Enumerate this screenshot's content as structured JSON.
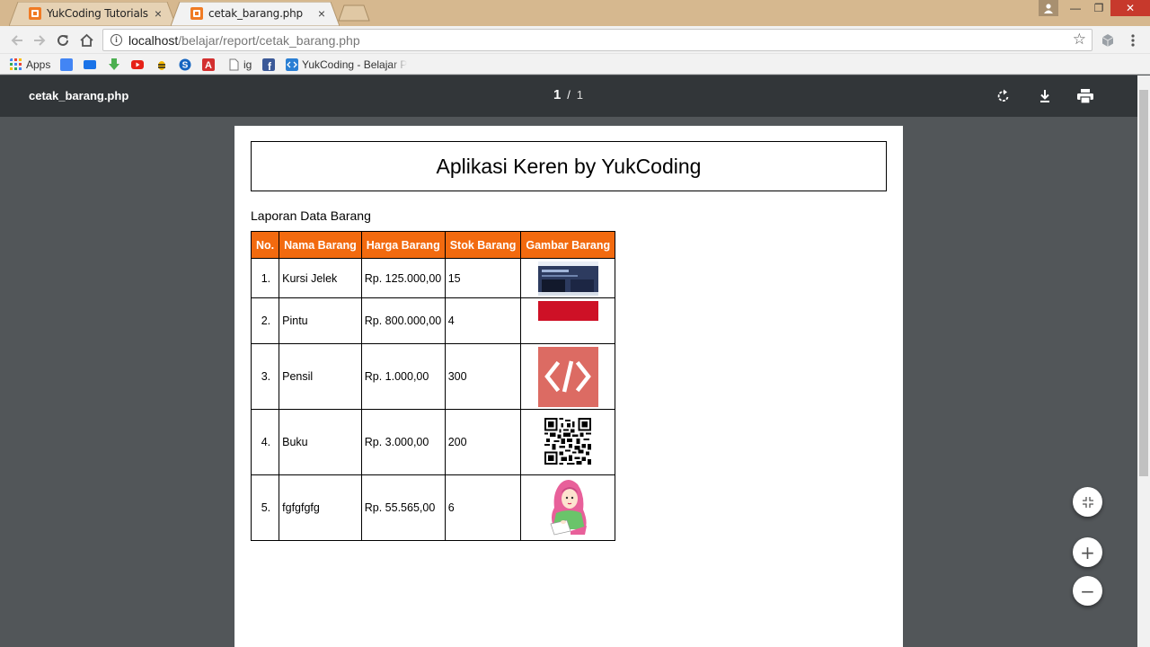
{
  "browser": {
    "tabs": [
      {
        "title": "YukCoding Tutorials",
        "close": "×",
        "active": false
      },
      {
        "title": "cetak_barang.php",
        "close": "×",
        "active": true
      }
    ],
    "window_controls": {
      "minimize": "—",
      "restore": "❐",
      "close": "✕"
    },
    "url": {
      "host": "localhost",
      "path": "/belajar/report/cetak_barang.php"
    },
    "bookmarks": [
      {
        "label": "Apps",
        "icon": "apps-grid-icon"
      },
      {
        "label": "",
        "icon": "translate-icon"
      },
      {
        "label": "",
        "icon": "reader-icon"
      },
      {
        "label": "",
        "icon": "download-arrow-icon"
      },
      {
        "label": "",
        "icon": "youtube-icon"
      },
      {
        "label": "",
        "icon": "bee-icon"
      },
      {
        "label": "",
        "icon": "s-circle-icon"
      },
      {
        "label": "",
        "icon": "red-a-icon"
      },
      {
        "label": "ig",
        "icon": "page-icon"
      },
      {
        "label": "",
        "icon": "facebook-icon"
      },
      {
        "label": "YukCoding - Belajar P",
        "icon": "code-icon"
      }
    ]
  },
  "pdf_viewer": {
    "filename": "cetak_barang.php",
    "page_current": "1",
    "page_separator": "/",
    "page_total": "1",
    "zoom_in": "+",
    "zoom_out": "−"
  },
  "document": {
    "header": "Aplikasi Keren by YukCoding",
    "report_title": "Laporan Data Barang",
    "columns": [
      "No.",
      "Nama Barang",
      "Harga Barang",
      "Stok Barang",
      "Gambar Barang"
    ],
    "rows": [
      {
        "no": "1.",
        "name": "Kursi Jelek",
        "price": "Rp. 125.000,00",
        "stock": "15",
        "image": "website-screenshot-thumbnail"
      },
      {
        "no": "2.",
        "name": "Pintu",
        "price": "Rp. 800.000,00",
        "stock": "4",
        "image": "red-white-flag-thumbnail"
      },
      {
        "no": "3.",
        "name": "Pensil",
        "price": "Rp. 1.000,00",
        "stock": "300",
        "image": "code-brackets-thumbnail"
      },
      {
        "no": "4.",
        "name": "Buku",
        "price": "Rp. 3.000,00",
        "stock": "200",
        "image": "qr-code-thumbnail"
      },
      {
        "no": "5.",
        "name": "fgfgfgfg",
        "price": "Rp. 55.565,00",
        "stock": "6",
        "image": "hijab-girl-thumbnail"
      }
    ]
  },
  "colors": {
    "tabstrip": "#d6b88f",
    "pdf_toolbar": "#323639",
    "viewer_bg": "#525659",
    "table_header": "#f26a0f"
  }
}
